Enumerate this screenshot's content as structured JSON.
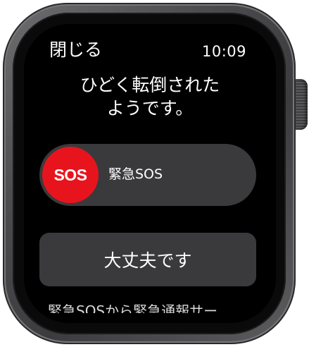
{
  "screen": {
    "close_label": "閉じる",
    "time": "10:09",
    "headline_line1": "ひどく転倒された",
    "headline_line2": "ようです。"
  },
  "sos_slider": {
    "knob_text": "SOS",
    "label": "緊急SOS"
  },
  "ok_button": {
    "label": "大丈夫です"
  },
  "footer": {
    "text": "緊急SOSから緊急通報サー"
  },
  "colors": {
    "sos_red": "#e8141d",
    "control_gray": "#3a3a3c",
    "screen_bg": "#000000"
  },
  "icons": {
    "crown": "digital-crown",
    "side_button": "side-button"
  }
}
